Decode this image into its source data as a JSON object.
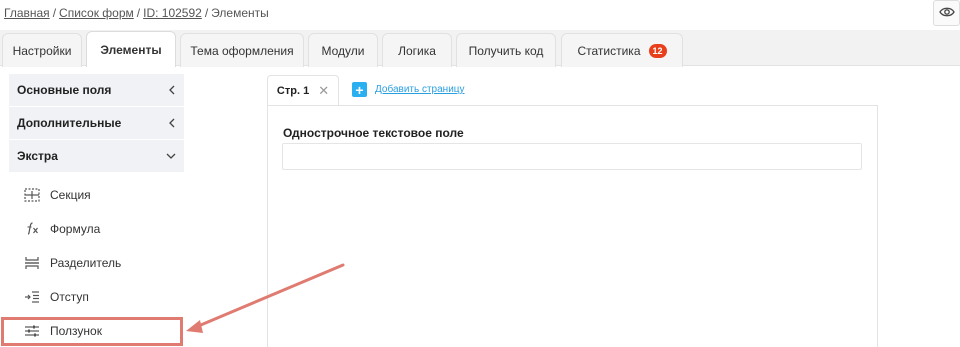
{
  "breadcrumb": {
    "home": "Главная",
    "forms": "Список форм",
    "id": "ID: 102592",
    "current": "Элементы",
    "separator": "/"
  },
  "tabs": [
    {
      "label": "Настройки"
    },
    {
      "label": "Элементы",
      "active": true
    },
    {
      "label": "Тема оформления"
    },
    {
      "label": "Модули"
    },
    {
      "label": "Логика"
    },
    {
      "label": "Получить код"
    },
    {
      "label": "Статистика",
      "badge": "12"
    }
  ],
  "sidebar": {
    "sections": [
      {
        "label": "Основные поля",
        "state": "collapsed"
      },
      {
        "label": "Дополнительные",
        "state": "collapsed"
      },
      {
        "label": "Экстра",
        "state": "expanded"
      }
    ],
    "items": [
      {
        "label": "Секция",
        "icon": "section-icon"
      },
      {
        "label": "Формула",
        "icon": "formula-icon"
      },
      {
        "label": "Разделитель",
        "icon": "divider-icon"
      },
      {
        "label": "Отступ",
        "icon": "indent-icon"
      },
      {
        "label": "Ползунок",
        "icon": "slider-icon"
      }
    ]
  },
  "pages": {
    "tab_label": "Стр. 1",
    "close_glyph": "✕",
    "add_label": "Добавить страницу"
  },
  "form": {
    "field_label": "Однострочное текстовое поле",
    "field_value": ""
  },
  "colors": {
    "badge": "#e8401c",
    "accent": "#2ab0f0",
    "highlight": "#e07b71"
  }
}
